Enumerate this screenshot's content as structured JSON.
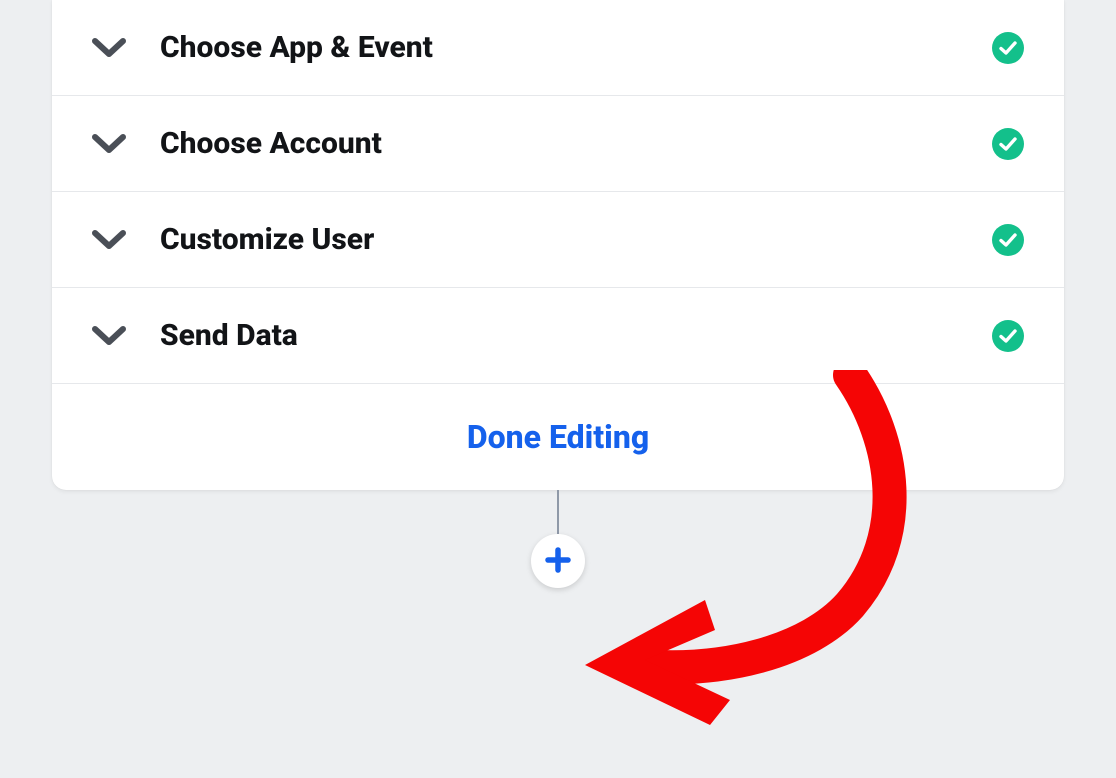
{
  "steps": [
    {
      "label": "Choose App & Event",
      "complete": true
    },
    {
      "label": "Choose Account",
      "complete": true
    },
    {
      "label": "Customize User",
      "complete": true
    },
    {
      "label": "Send Data",
      "complete": true
    }
  ],
  "footer": {
    "done_label": "Done Editing"
  },
  "colors": {
    "accent_blue": "#1561ec",
    "success_green": "#13c08b",
    "annotation_red": "#f50505"
  }
}
